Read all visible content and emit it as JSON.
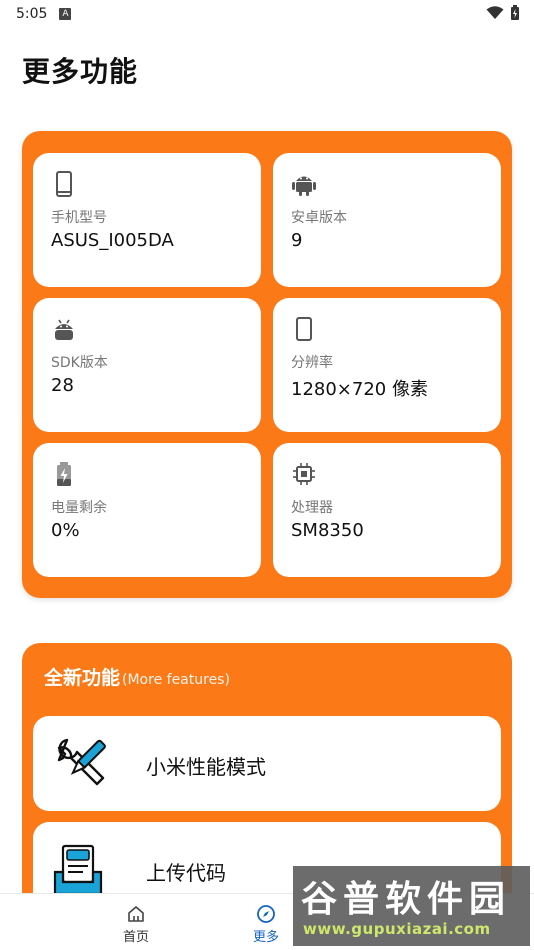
{
  "status": {
    "time": "5:05",
    "a_badge": "A"
  },
  "page": {
    "title": "更多功能"
  },
  "device_info": [
    {
      "icon": "phone-icon",
      "label": "手机型号",
      "value": "ASUS_I005DA"
    },
    {
      "icon": "android-icon",
      "label": "安卓版本",
      "value": "9"
    },
    {
      "icon": "android-head-icon",
      "label": "SDK版本",
      "value": "28"
    },
    {
      "icon": "screen-icon",
      "label": "分辨率",
      "value": "1280×720 像素"
    },
    {
      "icon": "battery-icon",
      "label": "电量剩余",
      "value": "0%"
    },
    {
      "icon": "cpu-icon",
      "label": "处理器",
      "value": "SM8350"
    }
  ],
  "features": {
    "title": "全新功能",
    "subtitle": "(More features)",
    "items": [
      {
        "icon": "tools-icon",
        "label": "小米性能模式"
      },
      {
        "icon": "upload-doc-icon",
        "label": "上传代码"
      }
    ]
  },
  "nav": {
    "home": "首页",
    "more": "更多"
  },
  "watermark": {
    "title": "谷普软件园",
    "url": "www.gupuxiazai.com"
  },
  "colors": {
    "accent": "#fb7a17",
    "nav_active": "#1565c0",
    "tile_icon": "#555555",
    "feature_icon": "#1aa3d6"
  }
}
